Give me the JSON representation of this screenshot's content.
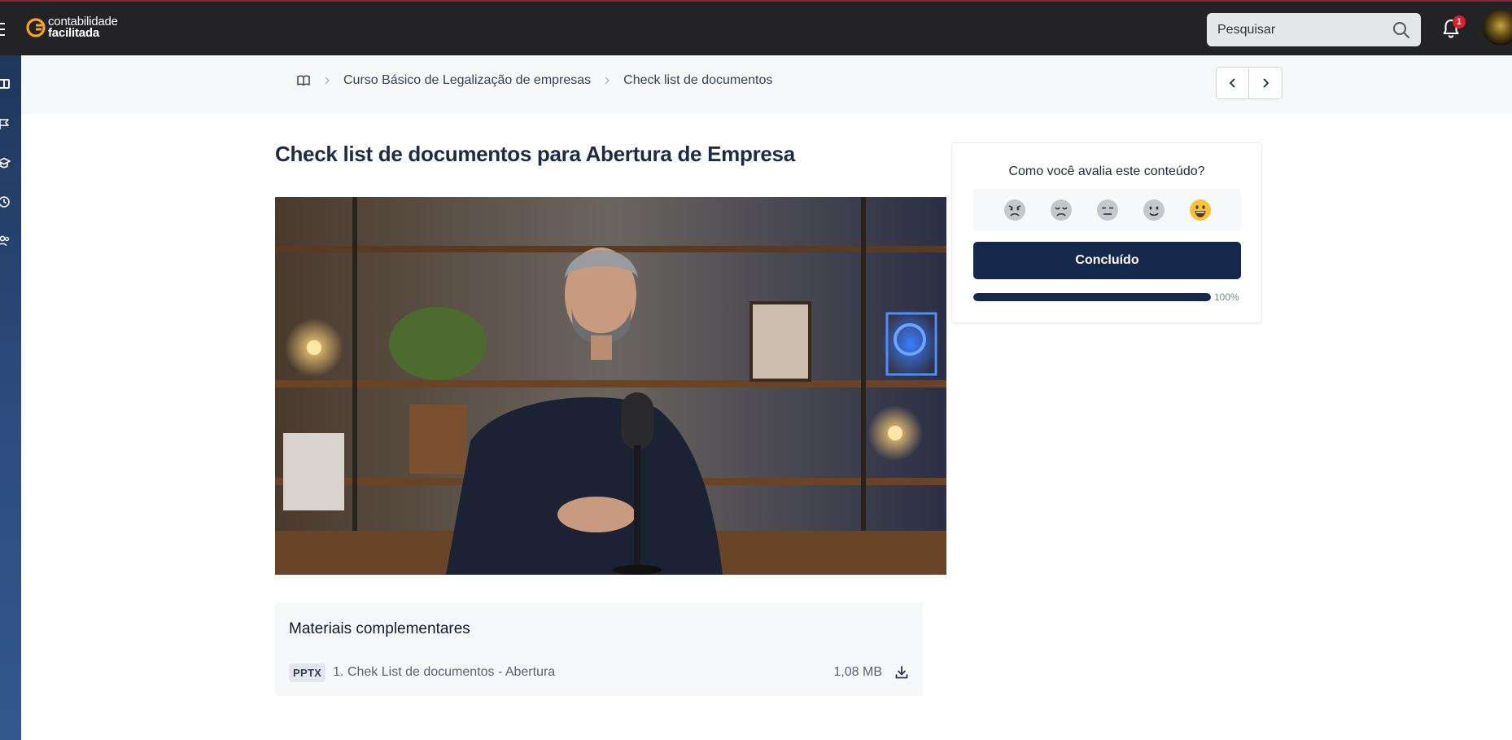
{
  "app": {
    "logo_line1": "contabilidade",
    "logo_line2": "facilitada",
    "brand_color": "#f5a623",
    "topbar_color": "#232325",
    "accent_color": "#15284b"
  },
  "header": {
    "search_placeholder": "Pesquisar",
    "notification_count": "1",
    "icons": [
      "menu-icon",
      "search-icon",
      "bell-icon",
      "avatar"
    ]
  },
  "sidebar": {
    "icons": [
      "dashboard-icon",
      "flag-icon",
      "graduation-cap-icon",
      "clock-icon",
      "people-icon"
    ]
  },
  "breadcrumb": {
    "home_icon": "book-icon",
    "items": [
      "Curso Básico de Legalização de empresas",
      "Check list de documentos"
    ]
  },
  "lesson": {
    "title": "Check list de documentos para Abertura de Empresa"
  },
  "materials": {
    "heading": "Materiais complementares",
    "files": [
      {
        "type": "PPTX",
        "name": "1. Chek List de documentos - Abertura",
        "size": "1,08 MB"
      }
    ]
  },
  "rating": {
    "question": "Como você avalia este conteúdo?",
    "options": [
      "angry-face-icon",
      "sad-face-icon",
      "neutral-face-icon",
      "slight-smile-icon",
      "happy-face-icon"
    ],
    "selected": "happy-face-icon",
    "done_label": "Concluído",
    "progress": 1.0,
    "progress_label": "100%"
  }
}
